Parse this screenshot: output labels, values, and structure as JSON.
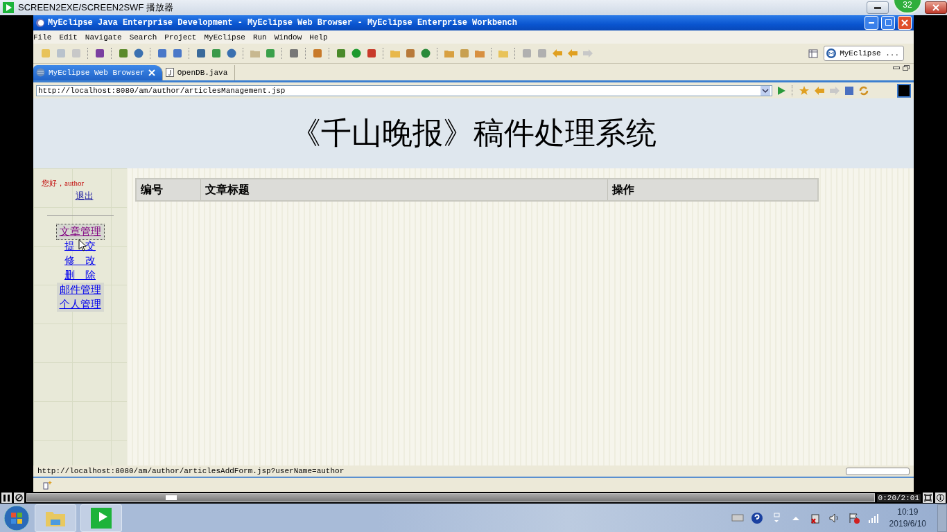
{
  "player": {
    "title": "SCREEN2EXE/SCREEN2SWF 播放器",
    "badge": "32"
  },
  "ide": {
    "title": "MyEclipse Java Enterprise Development - MyEclipse Web Browser - MyEclipse Enterprise Workbench",
    "menu": [
      "File",
      "Edit",
      "Navigate",
      "Search",
      "Project",
      "MyEclipse",
      "Run",
      "Window",
      "Help"
    ],
    "perspective": "MyEclipse ...",
    "tabs": [
      {
        "label": "MyEclipse Web Browser",
        "kind": "browser",
        "selected": true,
        "closable": true
      },
      {
        "label": "OpenDB.java",
        "kind": "java",
        "selected": false,
        "closable": false
      }
    ],
    "url": "http://localhost:8080/am/author/articlesManagement.jsp",
    "status": "http://localhost:8080/am/author/articlesAddForm.jsp?userName=author"
  },
  "page": {
    "heading": "《千山晚报》稿件处理系统",
    "greeting": "您好，author",
    "logout": "退出",
    "nav": [
      {
        "label": "文章管理",
        "kind": "section",
        "selected": true
      },
      {
        "label": "提　交",
        "kind": "sub",
        "selected": false
      },
      {
        "label": "修　改",
        "kind": "sub",
        "selected": false
      },
      {
        "label": "删　除",
        "kind": "sub",
        "selected": false
      },
      {
        "label": "邮件管理",
        "kind": "section",
        "selected": false
      },
      {
        "label": "个人管理",
        "kind": "section",
        "selected": false
      }
    ],
    "table": {
      "columns": [
        "编号",
        "文章标题",
        "操作"
      ]
    }
  },
  "playback": {
    "level": 0.17,
    "time": "0:20/2:01"
  },
  "taskbar": {
    "time": "10:19",
    "date": "2019/6/10"
  }
}
